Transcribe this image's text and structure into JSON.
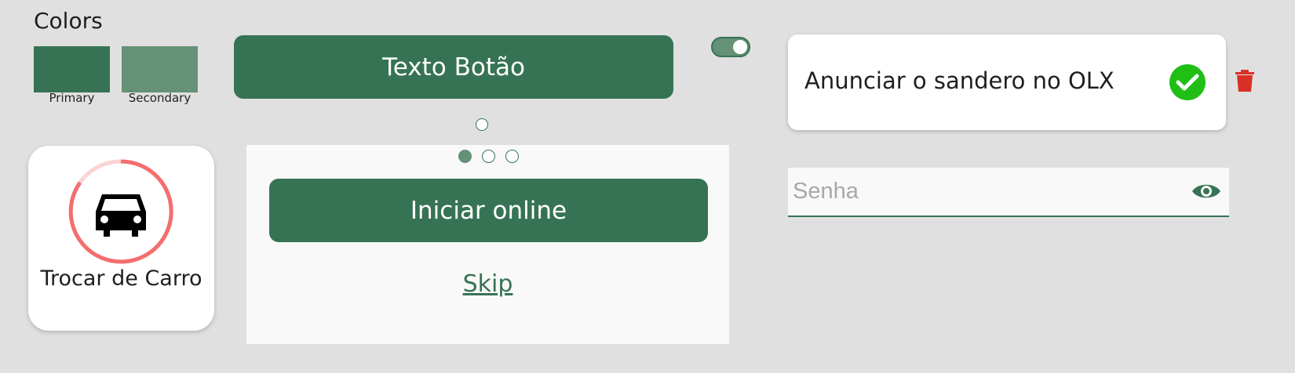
{
  "colors": {
    "title": "Colors",
    "primary": {
      "label": "Primary",
      "hex": "#367354"
    },
    "secondary": {
      "label": "Secondary",
      "hex": "#659176"
    }
  },
  "main_button": {
    "label": "Texto Botão"
  },
  "toggle": {
    "state": "on"
  },
  "task_card": {
    "text": "Anunciar o sandero no OLX",
    "status_icon": "check-icon",
    "delete_icon": "trash-icon"
  },
  "car_tile": {
    "label": "Trocar de Carro",
    "icon": "car-icon",
    "ring_color": "#f46e6e"
  },
  "onboarding": {
    "dots": [
      "active",
      "inactive",
      "inactive"
    ],
    "primary_button": "Iniciar online",
    "skip_link": "Skip"
  },
  "password_field": {
    "placeholder": "Senha",
    "icon": "eye-icon"
  },
  "accent_colors": {
    "check": "#1fbf16",
    "delete": "#d93025"
  }
}
